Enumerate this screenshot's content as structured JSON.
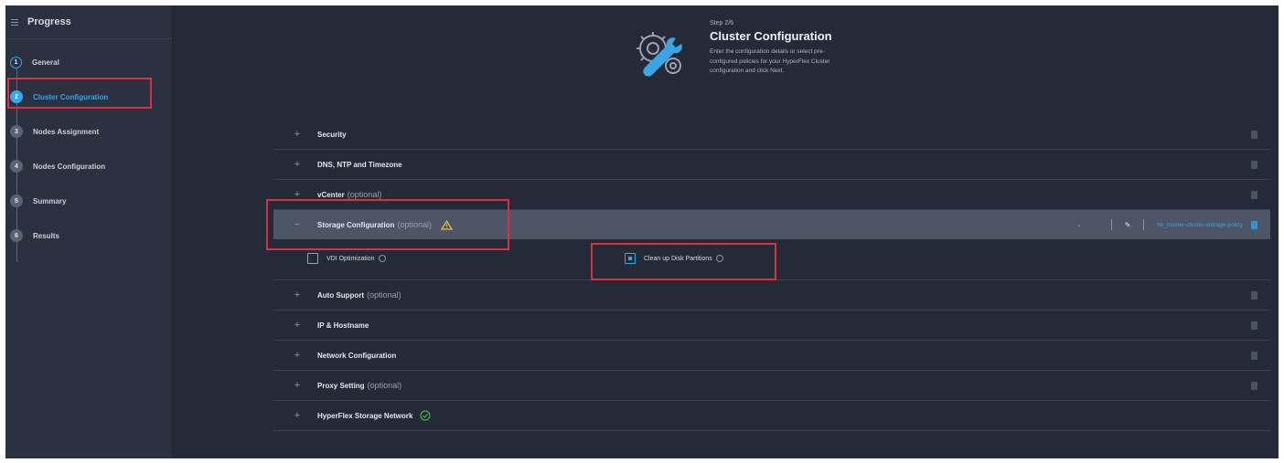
{
  "sidebar": {
    "title": "Progress",
    "steps": [
      {
        "num": "1",
        "label": "General",
        "state": "done"
      },
      {
        "num": "2",
        "label": "Cluster Configuration",
        "state": "active"
      },
      {
        "num": "3",
        "label": "Nodes Assignment",
        "state": "pending"
      },
      {
        "num": "4",
        "label": "Nodes Configuration",
        "state": "pending"
      },
      {
        "num": "5",
        "label": "Summary",
        "state": "pending"
      },
      {
        "num": "6",
        "label": "Results",
        "state": "pending"
      }
    ]
  },
  "header": {
    "step": "Step 2/6",
    "title": "Cluster Configuration",
    "description_lines": [
      "Enter the configuration details or select pre-",
      "configured policies for your HyperFlex Cluster",
      "configuration and click Next."
    ]
  },
  "sections": [
    {
      "label": "Security",
      "optional": ""
    },
    {
      "label": "DNS, NTP and Timezone",
      "optional": ""
    },
    {
      "label": "vCenter",
      "optional": "(optional)"
    },
    {
      "label": "Storage Configuration",
      "optional": "(optional)",
      "policy": "hx_cluster-cluster-storage-policy"
    },
    {
      "label": "Auto Support",
      "optional": "(optional)"
    },
    {
      "label": "IP & Hostname",
      "optional": ""
    },
    {
      "label": "Network Configuration",
      "optional": ""
    },
    {
      "label": "Proxy Setting",
      "optional": "(optional)"
    },
    {
      "label": "HyperFlex Storage Network",
      "optional": ""
    }
  ],
  "storage_options": {
    "vdi": {
      "label": "VDI Optimization",
      "checked": false
    },
    "cleanup": {
      "label": "Clean up Disk Partitions",
      "checked": true
    }
  },
  "colors": {
    "accent": "#3aa5e4",
    "highlight": "#d8313f",
    "warning": "#e3c04a",
    "success": "#3fb24b"
  },
  "icons": [
    "menu-icon",
    "gear-wrench-icon",
    "warning-icon",
    "check-circle-icon",
    "info-icon",
    "pencil-icon",
    "trash-icon",
    "chevron-down-icon"
  ]
}
